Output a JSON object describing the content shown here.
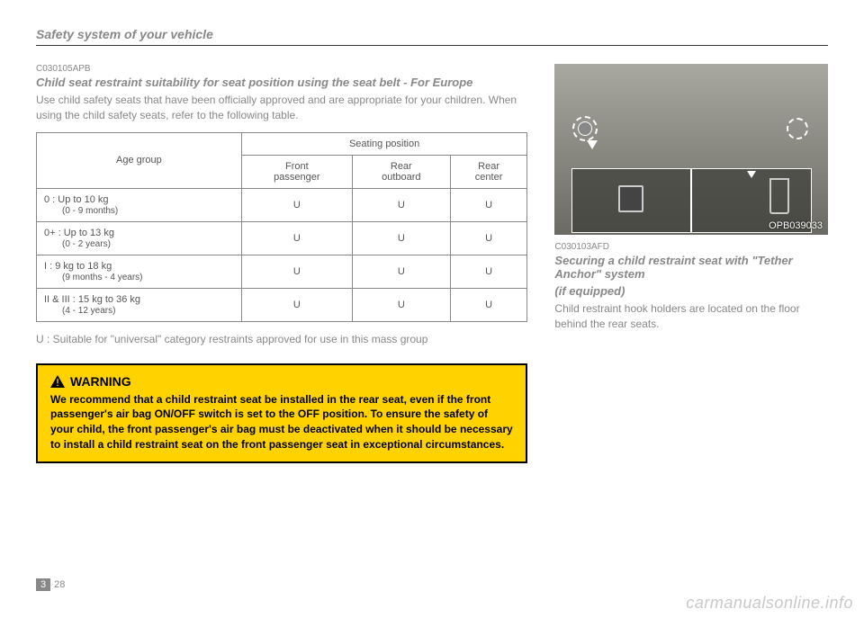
{
  "header": "Safety system of your vehicle",
  "section_code_left": "C030105APB",
  "subheading_left": "Child seat restraint suitability for seat position using the seat belt - For Europe",
  "intro_text": "Use child safety seats that have been officially approved and are appropriate for your children. When using the child safety seats, refer to the following table.",
  "table": {
    "age_group_header": "Age group",
    "seating_header": "Seating position",
    "col_front": "Front\npassenger",
    "col_rear_outboard": "Rear\noutboard",
    "col_rear_center": "Rear\ncenter",
    "rows": [
      {
        "label": "0   : Up to 10 kg",
        "sub": "(0 - 9 months)",
        "front": "U",
        "outboard": "U",
        "center": "U"
      },
      {
        "label": "0+ : Up to 13 kg",
        "sub": "(0 - 2 years)",
        "front": "U",
        "outboard": "U",
        "center": "U"
      },
      {
        "label": "I   : 9 kg to 18 kg",
        "sub": "(9 months - 4 years)",
        "front": "U",
        "outboard": "U",
        "center": "U"
      },
      {
        "label": "II & III : 15 kg to 36 kg",
        "sub": "(4 - 12 years)",
        "front": "U",
        "outboard": "U",
        "center": "U"
      }
    ]
  },
  "footnote": "U : Suitable for \"universal\" category restraints approved for use in this mass group",
  "warning": {
    "title": "WARNING",
    "text": "We recommend that a child restraint  seat be installed in the rear seat, even if the front passenger's air bag ON/OFF switch is set to the OFF position. To ensure the safety of your child, the front passenger's air bag must be deactivated when it should be necessary to install a child restraint seat on the front passenger seat in exceptional circumstances."
  },
  "photo_label": "OPB039033",
  "section_code_right": "C030103AFD",
  "subheading_right_1": "Securing a child restraint seat with \"Tether Anchor\" system",
  "subheading_right_2": "(if equipped)",
  "right_body": "Child restraint hook holders are located on the floor behind the rear seats.",
  "page_number_box": "3",
  "page_number": "28",
  "watermark": "carmanualsonline.info"
}
